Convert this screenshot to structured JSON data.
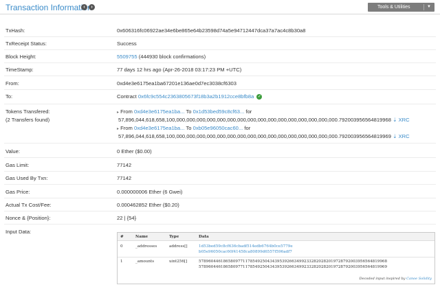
{
  "header": {
    "title": "Transaction Information",
    "tools_label": "Tools & Utilities"
  },
  "details": {
    "txhash": {
      "label": "TxHash:",
      "value": "0x606316fc06922ae34e6be865e64b23598d74a5e94712447dca37a7ac4c8b30a8"
    },
    "status": {
      "label": "TxReceipt Status:",
      "value": "Success"
    },
    "block": {
      "label": "Block Height:",
      "link": "5509755",
      "extra": "(444930 block confirmations)"
    },
    "timestamp": {
      "label": "TimeStamp:",
      "value": "77 days 12 hrs ago (Apr-26-2018 03:17:23 PM +UTC)"
    },
    "from": {
      "label": "From:",
      "value": "0xd4e3e6175ea1ba67201e136ae0d7ec3038cf6303"
    },
    "to": {
      "label": "To:",
      "prefix": "Contract",
      "value": "0x6fc9c554c2363805673f18b3a2b1912cce8bfb8a"
    },
    "tokens": {
      "label1": "Tokens Transfered:",
      "label2": "(2 Transfers found)",
      "transfers": [
        {
          "from_label": "From",
          "from": "0xd4e3e6175ea1ba...",
          "to_label": "To",
          "to": "0x1d53bed59c8cf63...",
          "for_label": "for",
          "amount": "57,896,044,618,658,100,000,000,000,000,000,000,000,000,000,000,000,000,000,000,000,000.792003956564819968",
          "token": "XRC"
        },
        {
          "from_label": "From",
          "from": "0xd4e3e6175ea1ba...",
          "to_label": "To",
          "to": "0xb05e96050cac60...",
          "for_label": "for",
          "amount": "57,896,044,618,658,100,000,000,000,000,000,000,000,000,000,000,000,000,000,000,000,000.792003956564819969",
          "token": "XRC"
        }
      ]
    },
    "value": {
      "label": "Value:",
      "value": "0 Ether ($0.00)"
    },
    "gas_limit": {
      "label": "Gas Limit:",
      "value": "77142"
    },
    "gas_used": {
      "label": "Gas Used By Txn:",
      "value": "77142"
    },
    "gas_price": {
      "label": "Gas Price:",
      "value": "0.000000006 Ether (6 Gwei)"
    },
    "cost": {
      "label": "Actual Tx Cost/Fee:",
      "value": "0.000462852 Ether ($0.20)"
    },
    "nonce": {
      "label": "Nonce & {Position}:",
      "value": "22 | {54}"
    },
    "input": {
      "label": "Input Data:"
    }
  },
  "input_table": {
    "headers": [
      "#",
      "Name",
      "Type",
      "Data"
    ],
    "rows": [
      {
        "idx": "0",
        "name": "_addresses",
        "type": "address[]",
        "data": [
          "1d53bed59c8cf636cbadf514edb6764b0ce5779e",
          "b05e96050cac60f41458ca80899d6557f596adf7"
        ]
      },
      {
        "idx": "1",
        "name": "_amounts",
        "type": "uint256[]",
        "data": [
          "57896044618658097711785492504343953926634992332820282019728792003956564819968",
          "57896044618658097711785492504343953926634992332820282019728792003956564819969"
        ]
      }
    ],
    "footer_text": "Decoded input inspired by",
    "footer_link": "Canoe Solidity"
  }
}
